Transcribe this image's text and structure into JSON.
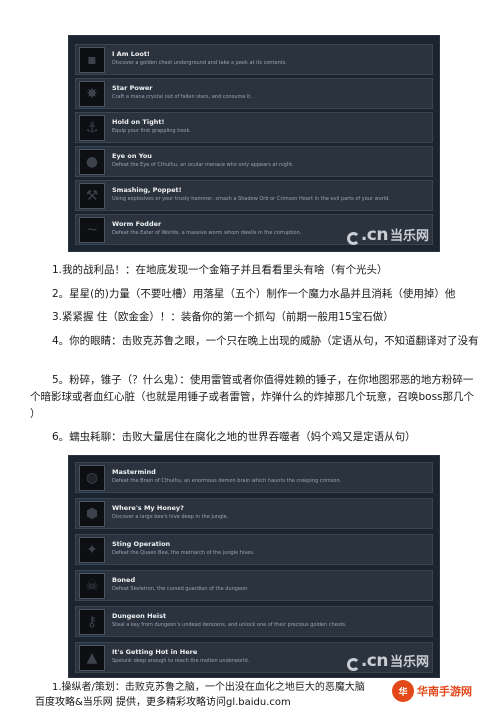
{
  "panel1": {
    "achievements": [
      {
        "title": "I Am Loot!",
        "desc": "Discover a golden chest underground and take a peek at its contents.",
        "icon": "chest-icon"
      },
      {
        "title": "Star Power",
        "desc": "Craft a mana crystal out of fallen stars, and consume it.",
        "icon": "star-icon"
      },
      {
        "title": "Hold on Tight!",
        "desc": "Equip your first grappling hook.",
        "icon": "hook-icon"
      },
      {
        "title": "Eye on You",
        "desc": "Defeat the Eye of Cthulhu, an ocular menace who only appears at night.",
        "icon": "eye-icon"
      },
      {
        "title": "Smashing, Poppet!",
        "desc": "Using explosives or your trusty hammer, smash a Shadow Orb or Crimson Heart in the evil parts of your world.",
        "icon": "hammer-icon"
      },
      {
        "title": "Worm Fodder",
        "desc": "Defeat the Eater of Worlds, a massive worm whom dwells in the corruption.",
        "icon": "worm-icon"
      }
    ]
  },
  "panel2": {
    "achievements": [
      {
        "title": "Mastermind",
        "desc": "Defeat the Brain of Cthulhu, an enormous demon brain which haunts the creeping crimson.",
        "icon": "brain-icon"
      },
      {
        "title": "Where's My Honey?",
        "desc": "Discover a large bee's hive deep in the jungle.",
        "icon": "hive-icon"
      },
      {
        "title": "Sting Operation",
        "desc": "Defeat the Queen Bee, the matriarch of the jungle hives.",
        "icon": "bee-icon"
      },
      {
        "title": "Boned",
        "desc": "Defeat Skeletron, the cursed guardian of the dungeon.",
        "icon": "skull-icon"
      },
      {
        "title": "Dungeon Heist",
        "desc": "Steal a key from dungeon's undead denizens, and unlock one of their precious golden chests.",
        "icon": "key-icon"
      },
      {
        "title": "It's Getting Hot in Here",
        "desc": "Spelunk deep enough to reach the molten underworld.",
        "icon": "flame-icon"
      }
    ]
  },
  "watermark": {
    "dcn": ".cn",
    "cn_text": "当乐网"
  },
  "paragraphs": {
    "p1": "1.我的战利品！：在地底发现一个金箱子并且看看里头有啥（有个光头）",
    "p2": "2。星星(的)力量（不要吐槽）用落星（五个）制作一个魔力水晶并且消耗（使用掉）他",
    "p3": "3.紧紧握   住（欧金金）！：装备你的第一个抓勾（前期一般用15宝石做）",
    "p4": "4。你的眼睛：击败克苏鲁之眼，一个只在晚上出现的威胁（定语从句，不知道翻译对了没有",
    "p5a": "5。粉碎，锥子（？什么鬼）：使用雷管或者你值得姓赖的锤子，在你地图邪恶的地方粉碎一",
    "p5b": "个暗影球或者血红心脏（也就是用锤子或者雷管，炸弹什么的炸掉那几个玩意，召唤boss那几个",
    "p5c": "）",
    "p6": "6。蠕虫耗聊：击败大量居住在腐化之地的世界吞噬者（妈个鸡又是定语从句）",
    "p7": "1.操纵者/策划：击败克苏鲁之脑，一个出没在血化之地巨大的恶魔大脑"
  },
  "footer": {
    "line1": "百度攻略&当乐网 提供，更多精彩攻略访问gl.baidu.com"
  },
  "logo": {
    "badge": "华",
    "text": "华南手游网"
  }
}
